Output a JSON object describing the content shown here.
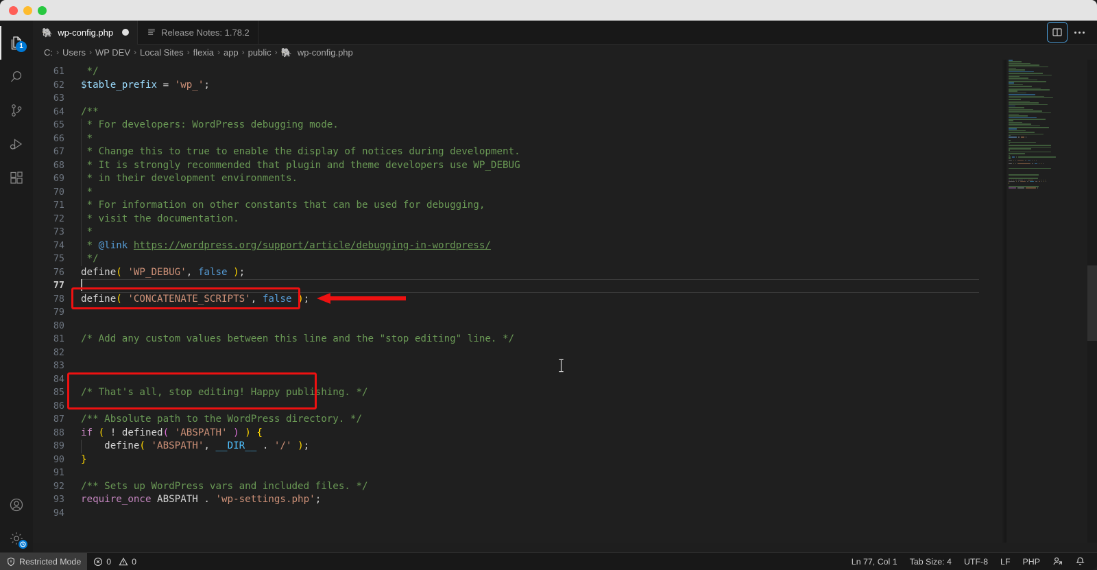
{
  "window": {
    "traffic_lights": [
      "close",
      "minimize",
      "maximize"
    ]
  },
  "activitybar": {
    "top_items": [
      {
        "name": "explorer",
        "icon": "files-icon",
        "badge": "1",
        "active": true
      },
      {
        "name": "search",
        "icon": "search-icon",
        "badge": "",
        "active": false
      },
      {
        "name": "source-control",
        "icon": "source-control-icon",
        "badge": "",
        "active": false
      },
      {
        "name": "run-and-debug",
        "icon": "run-debug-icon",
        "badge": "",
        "active": false
      },
      {
        "name": "extensions",
        "icon": "extensions-icon",
        "badge": "",
        "active": false
      }
    ],
    "bottom_items": [
      {
        "name": "accounts",
        "icon": "account-icon",
        "badge": ""
      },
      {
        "name": "manage-settings",
        "icon": "gear-icon",
        "badge": "sync-clock"
      }
    ]
  },
  "tabs": [
    {
      "label": "wp-config.php",
      "icon": "php-elephant-icon",
      "active": true,
      "dirty": true
    },
    {
      "label": "Release Notes: 1.78.2",
      "icon": "preview-lines-icon",
      "active": false,
      "dirty": false
    }
  ],
  "editor_actions": {
    "split_editor": "Split Editor Right",
    "more_actions": "More Actions..."
  },
  "breadcrumb": {
    "separator": "›",
    "items": [
      "C:",
      "Users",
      "WP DEV",
      "Local Sites",
      "flexia",
      "app",
      "public",
      "wp-config.php"
    ],
    "file_icon": "php-elephant-icon"
  },
  "editor": {
    "language": "PHP",
    "first_visible_line": 60,
    "cursor_line": 77,
    "code_lines": [
      {
        "n": 61,
        "tokens": [
          {
            "t": " */",
            "c": "cmt"
          }
        ]
      },
      {
        "n": 62,
        "tokens": [
          {
            "t": "$table_prefix",
            "c": "var"
          },
          {
            "t": " = ",
            "c": "plain"
          },
          {
            "t": "'wp_'",
            "c": "str"
          },
          {
            "t": ";",
            "c": "plain"
          }
        ]
      },
      {
        "n": 63,
        "tokens": []
      },
      {
        "n": 64,
        "tokens": [
          {
            "t": "/**",
            "c": "cmt"
          }
        ]
      },
      {
        "n": 65,
        "tokens": [
          {
            "t": " * For developers: WordPress debugging mode.",
            "c": "cmt"
          }
        ]
      },
      {
        "n": 66,
        "tokens": [
          {
            "t": " *",
            "c": "cmt"
          }
        ]
      },
      {
        "n": 67,
        "tokens": [
          {
            "t": " * Change this to true to enable the display of notices during development.",
            "c": "cmt"
          }
        ]
      },
      {
        "n": 68,
        "tokens": [
          {
            "t": " * It is strongly recommended that plugin and theme developers use WP_DEBUG",
            "c": "cmt"
          }
        ]
      },
      {
        "n": 69,
        "tokens": [
          {
            "t": " * in their development environments.",
            "c": "cmt"
          }
        ]
      },
      {
        "n": 70,
        "tokens": [
          {
            "t": " *",
            "c": "cmt"
          }
        ]
      },
      {
        "n": 71,
        "tokens": [
          {
            "t": " * For information on other constants that can be used for debugging,",
            "c": "cmt"
          }
        ]
      },
      {
        "n": 72,
        "tokens": [
          {
            "t": " * visit the documentation.",
            "c": "cmt"
          }
        ]
      },
      {
        "n": 73,
        "tokens": [
          {
            "t": " *",
            "c": "cmt"
          }
        ]
      },
      {
        "n": 74,
        "tokens": [
          {
            "t": " * ",
            "c": "cmt"
          },
          {
            "t": "@link",
            "c": "doc"
          },
          {
            "t": " ",
            "c": "cmt"
          },
          {
            "t": "https://wordpress.org/support/article/debugging-in-wordpress/",
            "c": "lnk"
          }
        ]
      },
      {
        "n": 75,
        "tokens": [
          {
            "t": " */",
            "c": "cmt"
          }
        ]
      },
      {
        "n": 76,
        "tokens": [
          {
            "t": "define",
            "c": "plain"
          },
          {
            "t": "(",
            "c": "par"
          },
          {
            "t": " ",
            "c": "plain"
          },
          {
            "t": "'WP_DEBUG'",
            "c": "str"
          },
          {
            "t": ", ",
            "c": "plain"
          },
          {
            "t": "false",
            "c": "kw"
          },
          {
            "t": " ",
            "c": "plain"
          },
          {
            "t": ")",
            "c": "par"
          },
          {
            "t": ";",
            "c": "plain"
          }
        ]
      },
      {
        "n": 77,
        "tokens": [],
        "cursor": true
      },
      {
        "n": 78,
        "tokens": [
          {
            "t": "define",
            "c": "plain"
          },
          {
            "t": "(",
            "c": "par"
          },
          {
            "t": " ",
            "c": "plain"
          },
          {
            "t": "'CONCATENATE_SCRIPTS'",
            "c": "str"
          },
          {
            "t": ", ",
            "c": "plain"
          },
          {
            "t": "false",
            "c": "kw"
          },
          {
            "t": " ",
            "c": "plain"
          },
          {
            "t": ")",
            "c": "par"
          },
          {
            "t": ";",
            "c": "plain"
          }
        ]
      },
      {
        "n": 79,
        "tokens": []
      },
      {
        "n": 80,
        "tokens": []
      },
      {
        "n": 81,
        "tokens": [
          {
            "t": "/* Add any custom values between this line and the \"stop editing\" line. */",
            "c": "cmt"
          }
        ]
      },
      {
        "n": 82,
        "tokens": []
      },
      {
        "n": 83,
        "tokens": []
      },
      {
        "n": 84,
        "tokens": []
      },
      {
        "n": 85,
        "tokens": [
          {
            "t": "/* That's all, stop editing! Happy publishing. */",
            "c": "cmt"
          }
        ]
      },
      {
        "n": 86,
        "tokens": []
      },
      {
        "n": 87,
        "tokens": [
          {
            "t": "/** Absolute path to the WordPress directory. */",
            "c": "cmt"
          }
        ]
      },
      {
        "n": 88,
        "tokens": [
          {
            "t": "if",
            "c": "ctl"
          },
          {
            "t": " ",
            "c": "plain"
          },
          {
            "t": "(",
            "c": "par"
          },
          {
            "t": " ! ",
            "c": "plain"
          },
          {
            "t": "defined",
            "c": "plain"
          },
          {
            "t": "(",
            "c": "par2"
          },
          {
            "t": " ",
            "c": "plain"
          },
          {
            "t": "'ABSPATH'",
            "c": "str"
          },
          {
            "t": " ",
            "c": "plain"
          },
          {
            "t": ")",
            "c": "par2"
          },
          {
            "t": " ",
            "c": "plain"
          },
          {
            "t": ")",
            "c": "par"
          },
          {
            "t": " ",
            "c": "plain"
          },
          {
            "t": "{",
            "c": "par"
          }
        ]
      },
      {
        "n": 89,
        "tokens": [
          {
            "t": "    define",
            "c": "plain"
          },
          {
            "t": "(",
            "c": "par"
          },
          {
            "t": " ",
            "c": "plain"
          },
          {
            "t": "'ABSPATH'",
            "c": "str"
          },
          {
            "t": ", ",
            "c": "plain"
          },
          {
            "t": "__DIR__",
            "c": "cnst"
          },
          {
            "t": " . ",
            "c": "plain"
          },
          {
            "t": "'/'",
            "c": "str"
          },
          {
            "t": " ",
            "c": "plain"
          },
          {
            "t": ")",
            "c": "par"
          },
          {
            "t": ";",
            "c": "plain"
          }
        ]
      },
      {
        "n": 90,
        "tokens": [
          {
            "t": "}",
            "c": "par"
          }
        ]
      },
      {
        "n": 91,
        "tokens": []
      },
      {
        "n": 92,
        "tokens": [
          {
            "t": "/** Sets up WordPress vars and included files. */",
            "c": "cmt"
          }
        ]
      },
      {
        "n": 93,
        "tokens": [
          {
            "t": "require_once",
            "c": "ctl"
          },
          {
            "t": " ABSPATH . ",
            "c": "plain"
          },
          {
            "t": "'wp-settings.php'",
            "c": "str"
          },
          {
            "t": ";",
            "c": "plain"
          }
        ]
      },
      {
        "n": 94,
        "tokens": []
      }
    ]
  },
  "annotations": {
    "color": "#ee1111",
    "boxes": [
      {
        "name": "concatenate-scripts-highlight",
        "target_line": 78
      },
      {
        "name": "stop-editing-highlight",
        "target_line": 85
      }
    ],
    "arrow": {
      "name": "pointer-arrow",
      "points_to_line": 78,
      "direction": "left"
    }
  },
  "statusbar": {
    "left": [
      {
        "name": "restricted-mode",
        "label": "Restricted Mode",
        "icon": "shield-icon"
      },
      {
        "name": "problems",
        "label_errors": "0",
        "label_warnings": "0",
        "icon_error": "error-circle-icon",
        "icon_warning": "warning-triangle-icon"
      }
    ],
    "right": [
      {
        "name": "editor-position",
        "label": "Ln 77, Col 1"
      },
      {
        "name": "indentation",
        "label": "Tab Size: 4"
      },
      {
        "name": "encoding",
        "label": "UTF-8"
      },
      {
        "name": "eol",
        "label": "LF"
      },
      {
        "name": "language-mode",
        "label": "PHP"
      },
      {
        "name": "live-share",
        "label": "",
        "icon": "live-share-icon"
      },
      {
        "name": "notifications",
        "label": "",
        "icon": "bell-icon"
      }
    ]
  },
  "colors": {
    "accent": "#0078d4",
    "annotation_red": "#ee1111",
    "editor_bg": "#1f1f1f",
    "activitybar_bg": "#1b1b1b",
    "statusbar_bg": "#181818",
    "comment_green": "#6a9955",
    "keyword_blue": "#569cd6",
    "string_orange": "#ce9178"
  }
}
